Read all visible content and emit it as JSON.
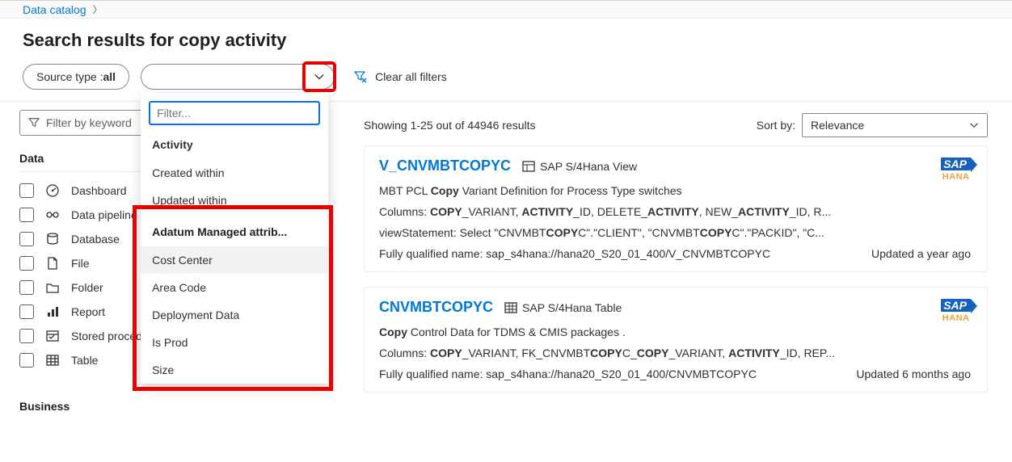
{
  "breadcrumb": {
    "root": "Data catalog"
  },
  "page_title": "Search results for copy activity",
  "filters": {
    "source_type_label": "Source type : ",
    "source_type_value": "all",
    "clear_label": "Clear all filters",
    "keyword_placeholder": "Filter by keyword"
  },
  "dropdown": {
    "filter_placeholder": "Filter...",
    "section_activity": "Activity",
    "items_activity": [
      "Created within",
      "Updated within"
    ],
    "section_managed": "Adatum Managed attrib...",
    "items_managed": [
      "Cost Center",
      "Area Code",
      "Deployment Data",
      "Is Prod",
      "Size"
    ]
  },
  "facets": {
    "data_header": "Data",
    "business_header": "Business",
    "items": [
      {
        "label": "Dashboard",
        "icon": "gauge"
      },
      {
        "label": "Data pipeline",
        "icon": "pipeline"
      },
      {
        "label": "Database",
        "icon": "database"
      },
      {
        "label": "File",
        "icon": "file"
      },
      {
        "label": "Folder",
        "icon": "folder"
      },
      {
        "label": "Report",
        "icon": "report"
      },
      {
        "label": "Stored procedure",
        "icon": "sproc"
      },
      {
        "label": "Table",
        "icon": "table"
      }
    ]
  },
  "results": {
    "showing_label": "Showing 1-25 out of 44946 results",
    "sort_label": "Sort by:",
    "sort_value": "Relevance",
    "cards": [
      {
        "title": "V_CNVMBTCOPYC",
        "kind": "SAP S/4Hana View",
        "badge_sub": "HANA",
        "desc_pre": "MBT PCL ",
        "desc_bold": "Copy",
        "desc_post": " Variant Definition for Process Type switches",
        "columns": "Columns: <b>COPY</b>_VARIANT, <b>ACTIVITY</b>_ID, DELETE_<b>ACTIVITY</b>, NEW_<b>ACTIVITY</b>_ID, R...",
        "view_stmt": "viewStatement: Select \"CNVMBT<b>COPY</b>C\".\"CLIENT\", \"CNVMBT<b>COPY</b>C\".\"PACKID\", \"C...",
        "fqn": "Fully qualified name: sap_s4hana://hana20_S20_01_400/V_CNVMBTCOPYC",
        "updated": "Updated a year ago"
      },
      {
        "title": "CNVMBTCOPYC",
        "kind": "SAP S/4Hana Table",
        "badge_sub": "HANA",
        "desc_pre": "",
        "desc_bold": "Copy",
        "desc_post": " Control Data for TDMS & CMIS packages .",
        "columns": "Columns: <b>COPY</b>_VARIANT, FK_CNVMBT<b>COPY</b>C_<b>COPY</b>_VARIANT, <b>ACTIVITY</b>_ID, REP...",
        "fqn": "Fully qualified name: sap_s4hana://hana20_S20_01_400/CNVMBTCOPYC",
        "updated": "Updated 6 months ago"
      }
    ]
  }
}
